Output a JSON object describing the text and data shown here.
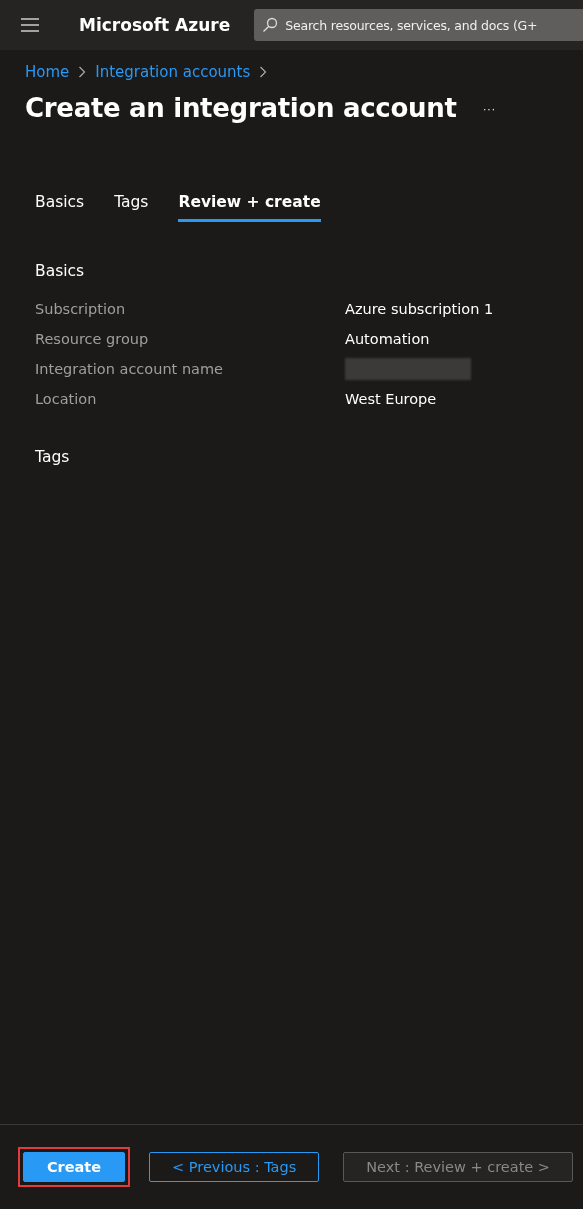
{
  "topbar": {
    "brand": "Microsoft Azure",
    "search": {
      "placeholder": "Search resources, services, and docs (G+"
    }
  },
  "breadcrumb": [
    "Home",
    "Integration accounts"
  ],
  "title": "Create an integration account",
  "more": "···",
  "tabs": [
    {
      "label": "Basics",
      "selected": false
    },
    {
      "label": "Tags",
      "selected": false
    },
    {
      "label": "Review + create",
      "selected": true
    }
  ],
  "sections": [
    {
      "heading": "Basics",
      "rows": [
        {
          "label": "Subscription",
          "value": "Azure subscription 1"
        },
        {
          "label": "Resource group",
          "value": "Automation"
        },
        {
          "label": "Integration account name",
          "redacted": true
        },
        {
          "label": "Location",
          "value": "West Europe"
        }
      ]
    },
    {
      "heading": "Tags"
    }
  ],
  "footer": [
    {
      "label": "Create",
      "kind": "primary",
      "highlighted": true,
      "disabled": false
    },
    {
      "label": "< Previous : Tags",
      "kind": "secondary",
      "highlighted": false,
      "disabled": false
    },
    {
      "label": "Next : Review + create >",
      "kind": "secondary",
      "highlighted": false,
      "disabled": true
    }
  ]
}
